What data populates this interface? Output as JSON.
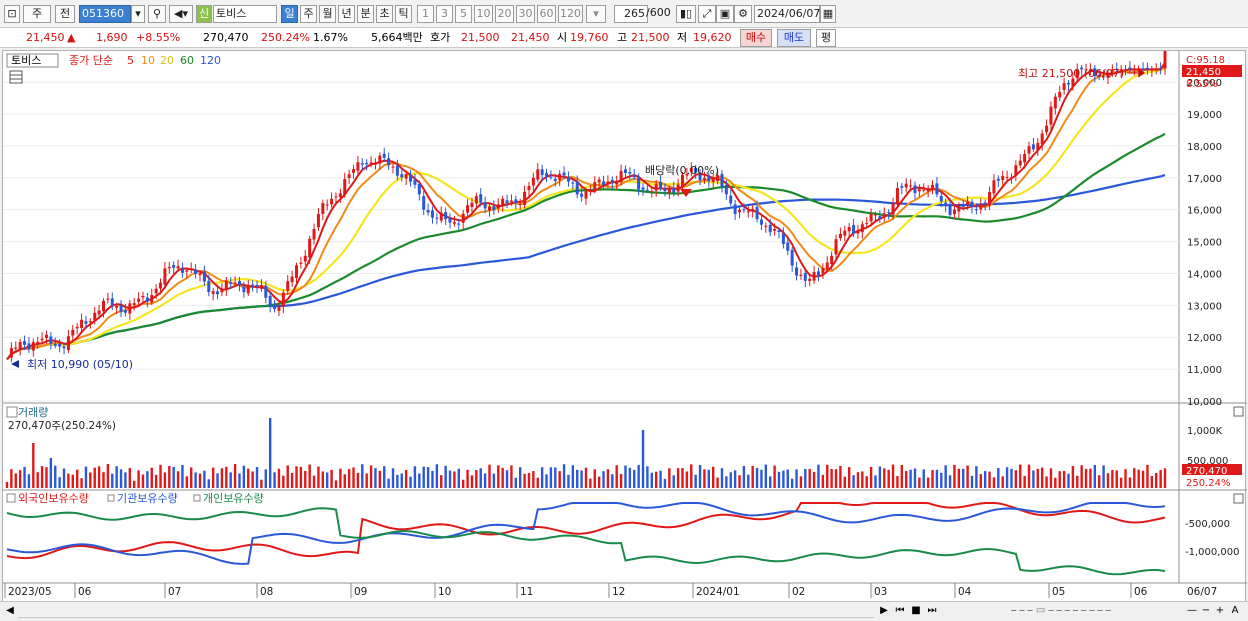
{
  "toolbar": {
    "market": "주",
    "prev_btn": "전",
    "code": "051360",
    "stock_tag": "신",
    "stock_name": "토비스",
    "periods": [
      "일",
      "주",
      "월",
      "년",
      "분",
      "초",
      "틱"
    ],
    "active_period": "일",
    "intervals": [
      "1",
      "3",
      "5",
      "10",
      "20",
      "30",
      "60",
      "120"
    ],
    "count": "265",
    "count_total": "/600",
    "date": "2024/06/07"
  },
  "info": {
    "price": "21,450",
    "arrow": "▲",
    "change": "1,690",
    "change_pct": "+8.55%",
    "volume": "270,470",
    "volume_pct": "250.24%",
    "turnover": "1.67%",
    "amount": "5,664백만",
    "bid_label": "호가",
    "bid1": "21,500",
    "bid2": "21,450",
    "open_label": "시",
    "open": "19,760",
    "high_label": "고",
    "high": "21,500",
    "low_label": "저",
    "low": "19,620",
    "buy_btn": "매수",
    "sell_btn": "매도",
    "eval_btn": "평"
  },
  "legend": {
    "name": "토비스",
    "close_label": "종가 단순",
    "ma": [
      "5",
      "10",
      "20",
      "60",
      "120"
    ],
    "ma_colors": [
      "#e01818",
      "#f08a18",
      "#f5e620",
      "#1a8a2a",
      "#2a58d8"
    ]
  },
  "price_panel": {
    "close_marker": "C:95.18",
    "last_price": "21,450",
    "last_pct": "8.55%",
    "high_note": "최고 21,500 (06/07)",
    "low_note": "최저 10,990 (05/10)",
    "dividend_note": "배당락(0.00%)",
    "yticks": [
      "20,000",
      "19,000",
      "18,000",
      "17,000",
      "16,000",
      "15,000",
      "14,000",
      "13,000",
      "12,000",
      "11,000",
      "10,000"
    ]
  },
  "volume_panel": {
    "title": "거래량",
    "value": "270,470주(250.24%)",
    "yticks": [
      "1,000K",
      "500,000"
    ],
    "last_value": "270,470",
    "last_pct": "250.24%"
  },
  "holding_panel": {
    "series": [
      "외국인보유수량",
      "기관보유수량",
      "개인보유수량"
    ],
    "colors": [
      "#e01818",
      "#2a58d8",
      "#1a8a4a"
    ],
    "yticks": [
      "-500,000",
      "-1,000,000"
    ]
  },
  "xaxis": [
    "2023/05",
    "06",
    "07",
    "08",
    "09",
    "10",
    "11",
    "12",
    "2024/01",
    "02",
    "03",
    "04",
    "05",
    "06",
    "06/07"
  ],
  "chart_data": {
    "type": "line",
    "title": "토비스",
    "x": [
      "2023/05",
      "06",
      "07",
      "08",
      "09",
      "10",
      "11",
      "12",
      "2024/01",
      "02",
      "03",
      "04",
      "05",
      "06"
    ],
    "series": [
      {
        "name": "종가",
        "values": [
          11300,
          12600,
          14100,
          13100,
          17900,
          15600,
          16900,
          16800,
          16900,
          13900,
          16600,
          16100,
          20200,
          21450
        ]
      }
    ],
    "ylim": [
      10000,
      20600
    ]
  }
}
